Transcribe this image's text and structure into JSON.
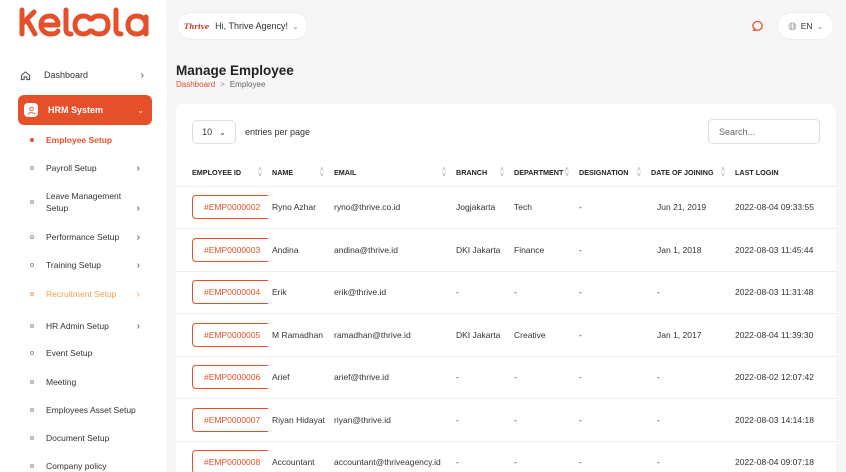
{
  "brand": {
    "name": "KELOLA",
    "color": "#e5502a"
  },
  "sidebar": {
    "dashboard": "Dashboard",
    "hrm": "HRM System",
    "items": [
      {
        "label": "Employee Setup",
        "arrow": ""
      },
      {
        "label": "Payroll Setup",
        "arrow": ">"
      },
      {
        "label": "Leave Management Setup",
        "arrow": ">"
      },
      {
        "label": "Performance Setup",
        "arrow": ">"
      },
      {
        "label": "Training Setup",
        "arrow": ">"
      },
      {
        "label": "Recruitment Setup",
        "arrow": ">"
      },
      {
        "label": "HR Admin Setup",
        "arrow": ">"
      },
      {
        "label": "Event Setup",
        "arrow": ""
      },
      {
        "label": "Meeting",
        "arrow": ""
      },
      {
        "label": "Employees Asset Setup",
        "arrow": ""
      },
      {
        "label": "Document Setup",
        "arrow": ""
      },
      {
        "label": "Company policy",
        "arrow": ""
      }
    ]
  },
  "topbar": {
    "company_logo_text": "Thrive",
    "greeting": "Hi, Thrive Agency!",
    "language": "EN"
  },
  "page": {
    "title": "Manage Employee",
    "breadcrumb": {
      "home": "Dashboard",
      "sep": ">",
      "current": "Employee"
    }
  },
  "table": {
    "per_page_value": "10",
    "per_page_label": "entries per page",
    "search_placeholder": "Search...",
    "columns": [
      "EMPLOYEE ID",
      "NAME",
      "EMAIL",
      "BRANCH",
      "DEPARTMENT",
      "DESIGNATION",
      "DATE OF JOINING",
      "LAST LOGIN"
    ],
    "rows": [
      {
        "id": "#EMP0000002",
        "name": "Ryno Azhar",
        "email": "ryno@thrive.co.id",
        "branch": "Jogjakarta",
        "department": "Tech",
        "designation": "-",
        "joined": "Jun 21, 2019",
        "last_login": "2022-08-04 09:33:55"
      },
      {
        "id": "#EMP0000003",
        "name": "Andina",
        "email": "andina@thrive.id",
        "branch": "DKI Jakarta",
        "department": "Finance",
        "designation": "-",
        "joined": "Jan 1, 2018",
        "last_login": "2022-08-03 11:45:44"
      },
      {
        "id": "#EMP0000004",
        "name": "Erik",
        "email": "erik@thrive.id",
        "branch": "-",
        "department": "-",
        "designation": "-",
        "joined": "-",
        "last_login": "2022-08-03 11:31:48"
      },
      {
        "id": "#EMP0000005",
        "name": "M Ramadhan",
        "email": "ramadhan@thrive.id",
        "branch": "DKI Jakarta",
        "department": "Creative",
        "designation": "-",
        "joined": "Jan 1, 2017",
        "last_login": "2022-08-04 11:39:30"
      },
      {
        "id": "#EMP0000006",
        "name": "Arief",
        "email": "arief@thrive.id",
        "branch": "-",
        "department": "-",
        "designation": "-",
        "joined": "-",
        "last_login": "2022-08-02 12:07:42"
      },
      {
        "id": "#EMP0000007",
        "name": "Riyan Hidayat",
        "email": "riyan@thrive.id",
        "branch": "-",
        "department": "-",
        "designation": "-",
        "joined": "-",
        "last_login": "2022-08-03 14:14:18"
      },
      {
        "id": "#EMP0000008",
        "name": "Accountant",
        "email": "accountant@thriveagency.id",
        "branch": "-",
        "department": "-",
        "designation": "-",
        "joined": "-",
        "last_login": "2022-08-04 09:07:18"
      }
    ]
  }
}
